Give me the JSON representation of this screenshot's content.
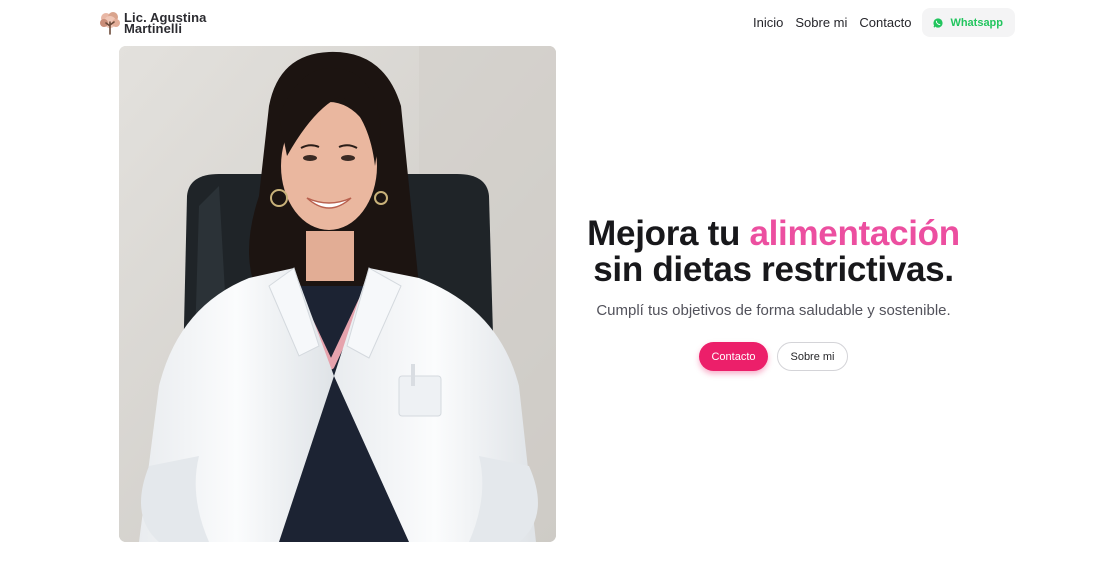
{
  "header": {
    "brand": {
      "line1": "Lic. Agustina",
      "line2": "Martinelli",
      "logo_icon": "tree-logo-icon"
    },
    "nav": {
      "items": [
        "Inicio",
        "Sobre mi",
        "Contacto"
      ],
      "whatsapp_label": "Whatsapp",
      "whatsapp_icon": "whatsapp-icon"
    }
  },
  "hero": {
    "photo_alt": "Portrait of the nutritionist in a white lab coat",
    "title_part1": "Mejora tu ",
    "title_accent": "alimentación",
    "title_part2": "sin dietas restrictivas.",
    "subtitle": "Cumplí tus objetivos de forma saludable y sostenible.",
    "primary_cta": "Contacto",
    "secondary_cta": "Sobre mi"
  },
  "colors": {
    "accent_pink": "#ec4fa0",
    "cta_pink": "#ec1f6a",
    "whatsapp_green": "#22c55e",
    "title_dark": "#18181b"
  }
}
